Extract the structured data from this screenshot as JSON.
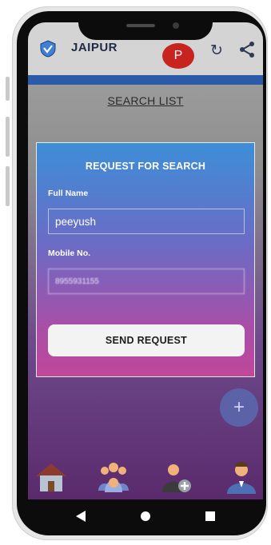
{
  "header": {
    "city": "JAIPUR",
    "avatar_letter": "P",
    "refresh_glyph": "↻",
    "icons": [
      "logo-icon",
      "refresh-icon",
      "share-icon"
    ]
  },
  "page": {
    "section_title": "SEARCH LIST",
    "fab_glyph": "+"
  },
  "modal": {
    "title": "REQUEST FOR SEARCH",
    "full_name_label": "Full Name",
    "full_name_value": "peeyush",
    "mobile_label": "Mobile No.",
    "mobile_value": "8955931155",
    "send_label": "SEND REQUEST"
  },
  "bottom_nav": [
    "home-icon",
    "group-icon",
    "add-user-icon",
    "profile-icon"
  ],
  "system_nav": [
    "back-icon",
    "home-circle-icon",
    "recents-icon"
  ],
  "colors": {
    "header_bg": "#d4d4d4",
    "accent_strip": "#2a5aa8",
    "avatar_bg": "#c8241f",
    "modal_top": "#3d8ed8",
    "modal_bottom": "#c0479b",
    "fab_bg": "#5b62a8"
  }
}
